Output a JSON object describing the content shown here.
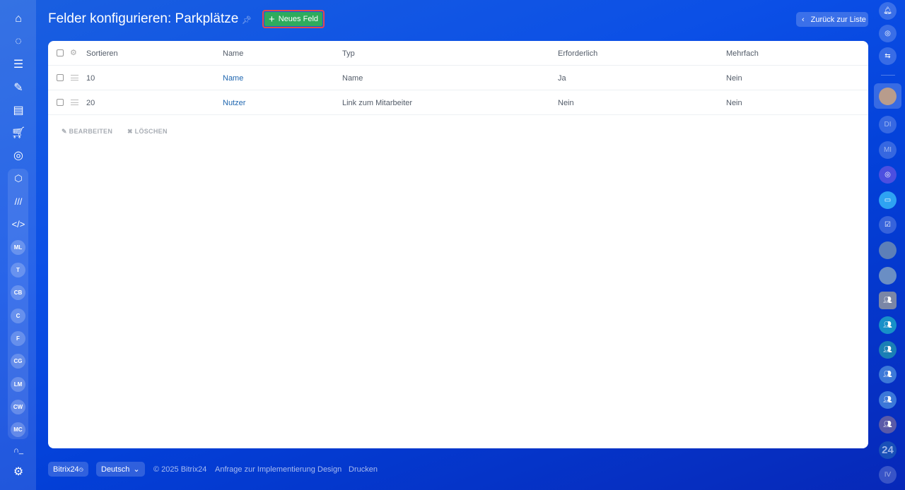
{
  "header": {
    "title": "Felder konfigurieren: Parkplätze",
    "new_field": "Neues Feld",
    "back": "Zurück zur Liste"
  },
  "table": {
    "columns": [
      "Sortieren",
      "Name",
      "Typ",
      "Erforderlich",
      "Mehrfach"
    ],
    "rows": [
      {
        "sort": "10",
        "name": "Name",
        "type": "Name",
        "required": "Ja",
        "multiple": "Nein"
      },
      {
        "sort": "20",
        "name": "Nutzer",
        "type": "Link zum Mitarbeiter",
        "required": "Nein",
        "multiple": "Nein"
      }
    ],
    "actions": {
      "edit": "BEARBEITEN",
      "delete": "LÖSCHEN"
    }
  },
  "left_sidebar": {
    "groups": [
      "ML",
      "T",
      "CB",
      "C",
      "F",
      "CG",
      "LM",
      "CW",
      "MC"
    ]
  },
  "right_sidebar": {
    "chats": [
      "DI",
      "MI"
    ],
    "brand": "24",
    "last": "IV"
  },
  "footer": {
    "brand": "Bitrix24",
    "language": "Deutsch",
    "copyright": "© 2025 Bitrix24",
    "links": [
      "Anfrage zur Implementierung",
      "Design",
      "Drucken"
    ]
  }
}
